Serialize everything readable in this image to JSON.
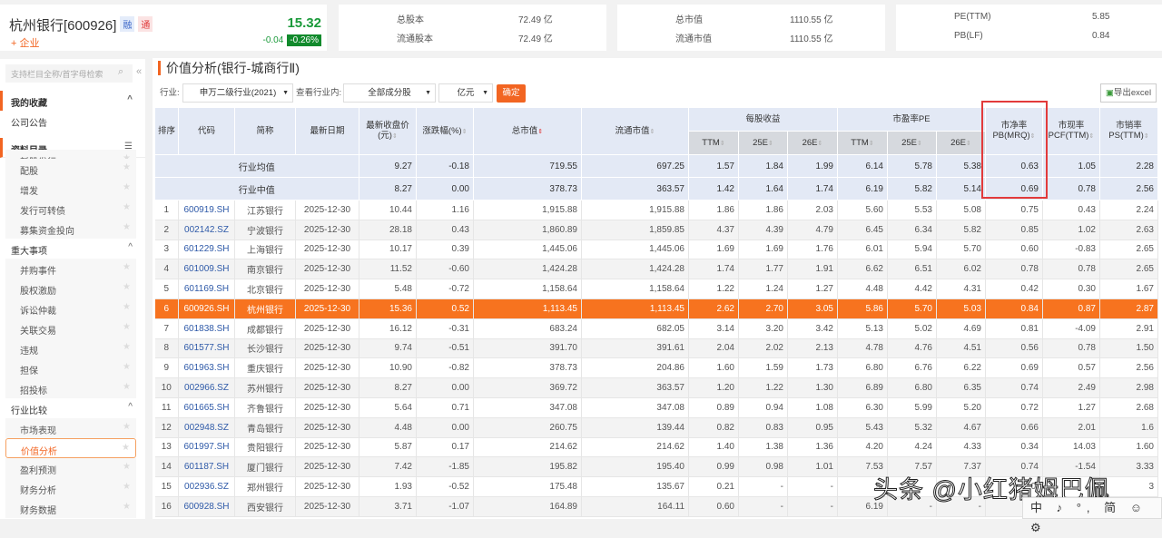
{
  "header": {
    "name": "杭州银行[600926]",
    "tag1": "融",
    "tag2": "通",
    "follow": "+ 企业",
    "price": "15.32",
    "change": "-0.04",
    "change_pct": "-0.26%"
  },
  "stats": [
    [
      "总股本",
      "72.49 亿"
    ],
    [
      "流通股本",
      "72.49 亿"
    ],
    [
      "总市值",
      "1110.55 亿"
    ],
    [
      "流通市值",
      "1110.55 亿"
    ],
    [
      "PE(TTM)",
      "5.85"
    ],
    [
      "PB(LF)",
      "0.84"
    ]
  ],
  "sidebar": {
    "search_placeholder": "支持栏目全称/首字母检索",
    "fav": "我的收藏",
    "notice": "公司公告",
    "catalog": "资料目录",
    "items1": [
      "新股发行",
      "配股",
      "增发",
      "发行可转债",
      "募集资金投向"
    ],
    "sec2": "重大事项",
    "items2": [
      "并购事件",
      "股权激励",
      "诉讼仲裁",
      "关联交易",
      "违规",
      "担保",
      "招投标"
    ],
    "sec3": "行业比较",
    "items3": [
      "市场表现",
      "价值分析",
      "盈利预测",
      "财务分析",
      "财务数据"
    ]
  },
  "main": {
    "title": "价值分析(银行-城商行Ⅱ)",
    "industry_label": "行业:",
    "industry": "申万二级行业(2021)",
    "view_label": "查看行业内:",
    "scope": "全部成分股",
    "unit": "亿元",
    "confirm": "确定",
    "export": "导出excel"
  },
  "table": {
    "headers": {
      "rank": "排序",
      "code": "代码",
      "name": "简称",
      "date": "最新日期",
      "close": "最新收盘价(元)",
      "pct": "涨跌幅(%)",
      "mcap": "总市值",
      "fmcap": "流通市值",
      "eps": "每股收益",
      "pe": "市盈率PE",
      "pb": "市净率PB(MRQ)",
      "pcf": "市现率PCF(TTM)",
      "ps": "市销率PS(TTM)",
      "ttm": "TTM",
      "e25": "25E",
      "e26": "26E"
    },
    "summary": [
      [
        "行业均值",
        "9.27",
        "-0.18",
        "719.55",
        "697.25",
        "1.57",
        "1.84",
        "1.99",
        "6.14",
        "5.78",
        "5.38",
        "0.63",
        "1.05",
        "2.28"
      ],
      [
        "行业中值",
        "8.27",
        "0.00",
        "378.73",
        "363.57",
        "1.42",
        "1.64",
        "1.74",
        "6.19",
        "5.82",
        "5.14",
        "0.69",
        "0.78",
        "2.56"
      ]
    ],
    "rows": [
      [
        "1",
        "600919.SH",
        "江苏银行",
        "2025-12-30",
        "10.44",
        "1.16",
        "1,915.88",
        "1,915.88",
        "1.86",
        "1.86",
        "2.03",
        "5.60",
        "5.53",
        "5.08",
        "0.75",
        "0.43",
        "2.24"
      ],
      [
        "2",
        "002142.SZ",
        "宁波银行",
        "2025-12-30",
        "28.18",
        "0.43",
        "1,860.89",
        "1,859.85",
        "4.37",
        "4.39",
        "4.79",
        "6.45",
        "6.34",
        "5.82",
        "0.85",
        "1.02",
        "2.63"
      ],
      [
        "3",
        "601229.SH",
        "上海银行",
        "2025-12-30",
        "10.17",
        "0.39",
        "1,445.06",
        "1,445.06",
        "1.69",
        "1.69",
        "1.76",
        "6.01",
        "5.94",
        "5.70",
        "0.60",
        "-0.83",
        "2.65"
      ],
      [
        "4",
        "601009.SH",
        "南京银行",
        "2025-12-30",
        "11.52",
        "-0.60",
        "1,424.28",
        "1,424.28",
        "1.74",
        "1.77",
        "1.91",
        "6.62",
        "6.51",
        "6.02",
        "0.78",
        "0.78",
        "2.65"
      ],
      [
        "5",
        "601169.SH",
        "北京银行",
        "2025-12-30",
        "5.48",
        "-0.72",
        "1,158.64",
        "1,158.64",
        "1.22",
        "1.24",
        "1.27",
        "4.48",
        "4.42",
        "4.31",
        "0.42",
        "0.30",
        "1.67"
      ],
      [
        "6",
        "600926.SH",
        "杭州银行",
        "2025-12-30",
        "15.36",
        "0.52",
        "1,113.45",
        "1,113.45",
        "2.62",
        "2.70",
        "3.05",
        "5.86",
        "5.70",
        "5.03",
        "0.84",
        "0.87",
        "2.87"
      ],
      [
        "7",
        "601838.SH",
        "成都银行",
        "2025-12-30",
        "16.12",
        "-0.31",
        "683.24",
        "682.05",
        "3.14",
        "3.20",
        "3.42",
        "5.13",
        "5.02",
        "4.69",
        "0.81",
        "-4.09",
        "2.91"
      ],
      [
        "8",
        "601577.SH",
        "长沙银行",
        "2025-12-30",
        "9.74",
        "-0.51",
        "391.70",
        "391.61",
        "2.04",
        "2.02",
        "2.13",
        "4.78",
        "4.76",
        "4.51",
        "0.56",
        "0.78",
        "1.50"
      ],
      [
        "9",
        "601963.SH",
        "重庆银行",
        "2025-12-30",
        "10.90",
        "-0.82",
        "378.73",
        "204.86",
        "1.60",
        "1.59",
        "1.73",
        "6.80",
        "6.76",
        "6.22",
        "0.69",
        "0.57",
        "2.56"
      ],
      [
        "10",
        "002966.SZ",
        "苏州银行",
        "2025-12-30",
        "8.27",
        "0.00",
        "369.72",
        "363.57",
        "1.20",
        "1.22",
        "1.30",
        "6.89",
        "6.80",
        "6.35",
        "0.74",
        "2.49",
        "2.98"
      ],
      [
        "11",
        "601665.SH",
        "齐鲁银行",
        "2025-12-30",
        "5.64",
        "0.71",
        "347.08",
        "347.08",
        "0.89",
        "0.94",
        "1.08",
        "6.30",
        "5.99",
        "5.20",
        "0.72",
        "1.27",
        "2.68"
      ],
      [
        "12",
        "002948.SZ",
        "青岛银行",
        "2025-12-30",
        "4.48",
        "0.00",
        "260.75",
        "139.44",
        "0.82",
        "0.83",
        "0.95",
        "5.43",
        "5.32",
        "4.67",
        "0.66",
        "2.01",
        "1.6"
      ],
      [
        "13",
        "601997.SH",
        "贵阳银行",
        "2025-12-30",
        "5.87",
        "0.17",
        "214.62",
        "214.62",
        "1.40",
        "1.38",
        "1.36",
        "4.20",
        "4.24",
        "4.33",
        "0.34",
        "14.03",
        "1.60"
      ],
      [
        "14",
        "601187.SH",
        "厦门银行",
        "2025-12-30",
        "7.42",
        "-1.85",
        "195.82",
        "195.40",
        "0.99",
        "0.98",
        "1.01",
        "7.53",
        "7.57",
        "7.37",
        "0.74",
        "-1.54",
        "3.33"
      ],
      [
        "15",
        "002936.SZ",
        "郑州银行",
        "2025-12-30",
        "1.93",
        "-0.52",
        "175.48",
        "135.67",
        "0.21",
        "-",
        "-",
        "9.",
        "",
        "",
        "0.",
        "",
        "3"
      ],
      [
        "16",
        "600928.SH",
        "西安银行",
        "2025-12-30",
        "3.71",
        "-1.07",
        "164.89",
        "164.11",
        "0.60",
        "-",
        "-",
        "6.19",
        "-",
        "-",
        "",
        "",
        ""
      ]
    ]
  },
  "watermark": "头条 @小红猪姆巴佩",
  "ime": "中 ♪ °, 简 ☺ ⚙"
}
